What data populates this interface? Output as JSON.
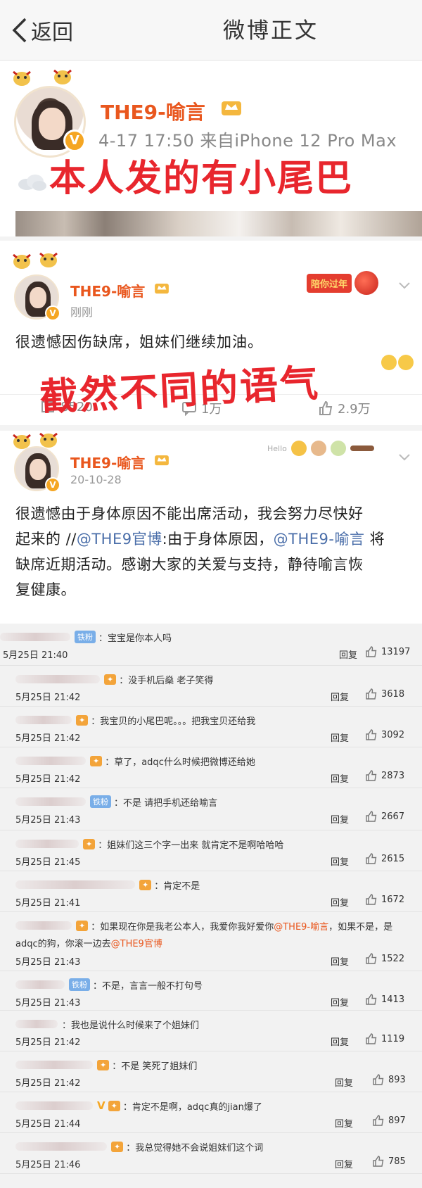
{
  "header": {
    "back_label": "返回",
    "title": "微博正文"
  },
  "post1": {
    "name": "THE9-喻言",
    "meta": "4-17 17:50  来自iPhone 12 Pro Max",
    "overlay": "本人发的有小尾巴"
  },
  "post2": {
    "name": "THE9-喻言",
    "time": "刚刚",
    "badge": "陪你过年",
    "body": "很遗憾因伤缺席，姐妹们继续加油。",
    "reposts": "8520",
    "comments": "1万",
    "likes": "2.9万",
    "overlay": "截然不同的语气"
  },
  "post3": {
    "name": "THE9-喻言",
    "time": "20-10-28",
    "deco_text": "Hello",
    "body_line1": "很遗憾由于身体原因不能出席活动，我会努力尽快好",
    "body_line2a": "起来的 //",
    "mention1": "@THE9官博",
    "body_line2b": ":由于身体原因，",
    "mention2": "@THE9-喻言",
    "body_line2c": " 将",
    "body_line3": "缺席近期活动。感谢大家的关爱与支持，静待喻言恢",
    "body_line4": "复健康。"
  },
  "comments": {
    "reply_label": "回复",
    "fan_iron": "铁粉",
    "items": [
      {
        "text": "：宝宝是你本人吗",
        "date": "5月25日 21:40",
        "likes": "13197"
      },
      {
        "text": "：没手机后燊 老子笑得",
        "date": "5月25日 21:42",
        "likes": "3618"
      },
      {
        "text": "：我宝贝的小尾巴呢。。。把我宝贝还给我",
        "date": "5月25日 21:42",
        "likes": "3092"
      },
      {
        "text": "：草了，adqc什么时候把微博还给她",
        "date": "5月25日 21:42",
        "likes": "2873"
      },
      {
        "text": "：不是 请把手机还给喻言",
        "date": "5月25日 21:43",
        "likes": "2667"
      },
      {
        "text": "：姐妹们这三个字一出来 就肯定不是啊哈哈哈",
        "date": "5月25日 21:45",
        "likes": "2615"
      },
      {
        "text": "：肯定不是",
        "date": "5月25日 21:41",
        "likes": "1672"
      },
      {
        "text": "：如果现在你是我老公本人，我爱你我好爱你",
        "mention": "@THE9-喻言",
        "text2": "，如果不是，是",
        "line2": "adqc的狗，你滚一边去",
        "mention_b": "@THE9官博",
        "date": "5月25日 21:43",
        "likes": "1522"
      },
      {
        "text": "：不是，言言一般不打句号",
        "date": "5月25日 21:43",
        "likes": "1413"
      },
      {
        "text": "：我也是说什么时候来了个姐妹们",
        "date": "5月25日 21:42",
        "likes": "1119"
      },
      {
        "text": "：不是 笑死了姐妹们",
        "date": "5月25日 21:42",
        "likes": "893"
      },
      {
        "text": "：肯定不是啊，adqc真的jian爆了",
        "date": "5月25日 21:44",
        "likes": "897"
      },
      {
        "text": "：我总觉得她不会说姐妹们这个词",
        "date": "5月25日 21:46",
        "likes": "785"
      }
    ]
  }
}
